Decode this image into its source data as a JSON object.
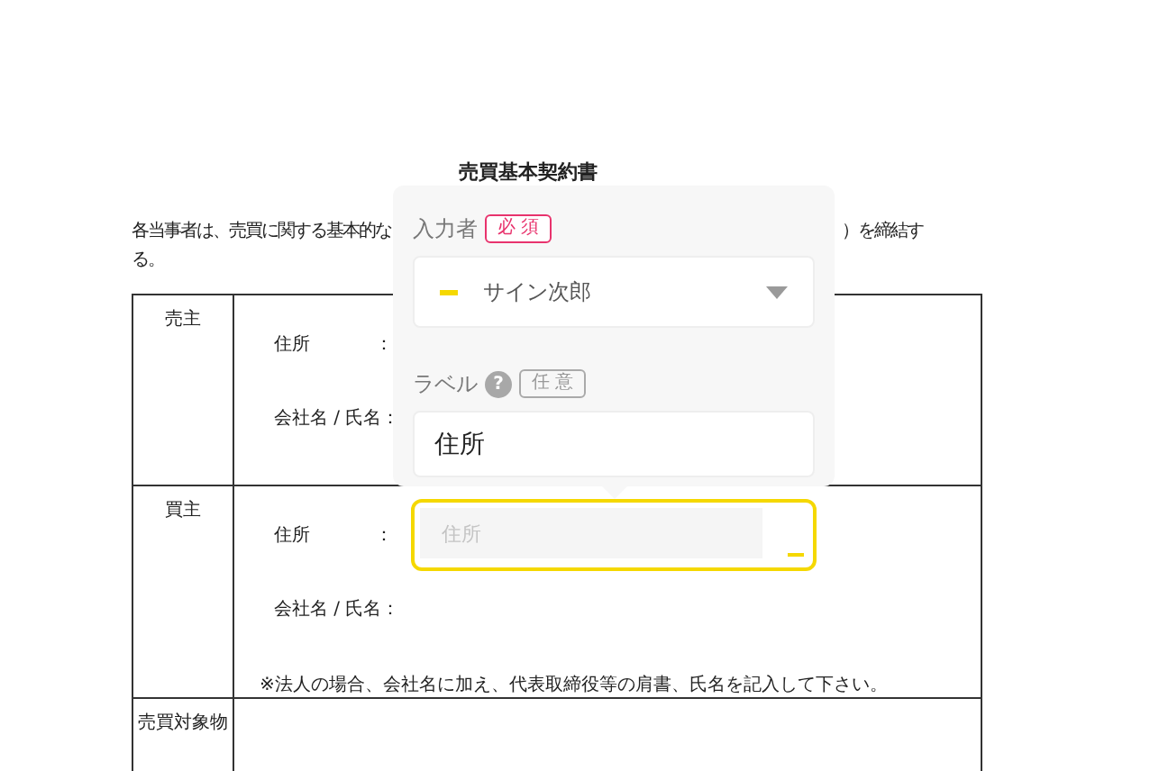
{
  "document": {
    "title": "売買基本契約書",
    "intro_visible": [
      "各当事者は、売買に関する基本的な",
      "）を締結す",
      "る。"
    ],
    "rows": [
      {
        "heading": "売主",
        "fields": [
          {
            "label": "住所",
            "separator": "："
          },
          {
            "label": "会社名 / 氏名："
          }
        ]
      },
      {
        "heading": "買主",
        "fields": [
          {
            "label": "住所",
            "separator": "："
          },
          {
            "label": "会社名 / 氏名："
          }
        ],
        "note": "※法人の場合、会社名に加え、代表取締役等の肩書、氏名を記入して下さい。"
      },
      {
        "heading": "売買対象物",
        "fields": []
      }
    ]
  },
  "popover": {
    "assignee": {
      "label": "入力者",
      "badge": "必 須",
      "value": "サイン次郎",
      "color": "#f5d800"
    },
    "label_field": {
      "label": "ラベル",
      "help": "?",
      "badge": "任 意",
      "value": "住所"
    }
  },
  "active_field": {
    "placeholder": "住所",
    "selected": true,
    "color": "#f5d800"
  }
}
